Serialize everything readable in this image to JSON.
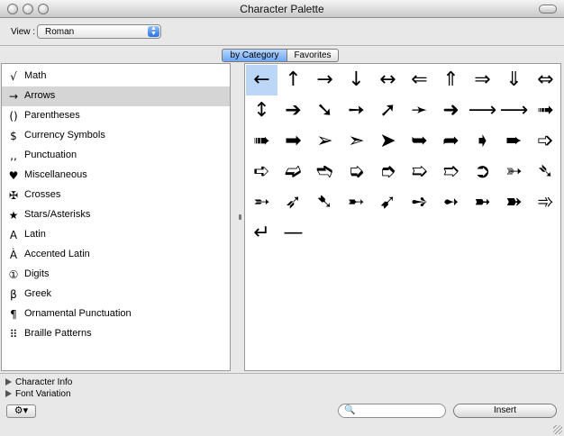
{
  "window": {
    "title": "Character Palette"
  },
  "toolbar": {
    "view_label": "View :",
    "view_value": "Roman"
  },
  "tabs": [
    {
      "label": "by Category",
      "selected": true
    },
    {
      "label": "Favorites",
      "selected": false
    }
  ],
  "categories": [
    {
      "icon": "√",
      "label": "Math"
    },
    {
      "icon": "→",
      "label": "Arrows",
      "selected": true
    },
    {
      "icon": "()",
      "label": "Parentheses"
    },
    {
      "icon": "$",
      "label": "Currency Symbols"
    },
    {
      "icon": "‚‚",
      "label": "Punctuation"
    },
    {
      "icon": "♥",
      "label": "Miscellaneous"
    },
    {
      "icon": "✠",
      "label": "Crosses"
    },
    {
      "icon": "★",
      "label": "Stars/Asterisks"
    },
    {
      "icon": "A",
      "label": "Latin"
    },
    {
      "icon": "À",
      "label": "Accented Latin"
    },
    {
      "icon": "①",
      "label": "Digits"
    },
    {
      "icon": "β",
      "label": "Greek"
    },
    {
      "icon": "¶",
      "label": "Ornamental Punctuation"
    },
    {
      "icon": "⠿",
      "label": "Braille Patterns"
    }
  ],
  "characters": [
    "←",
    "↑",
    "→",
    "↓",
    "↔",
    "⇐",
    "⇑",
    "⇒",
    "⇓",
    "⇔",
    "↕",
    "➔",
    "➘",
    "➙",
    "➚",
    "➛",
    "➜",
    "⟶",
    "⟶",
    "➟",
    "➠",
    "➡",
    "➢",
    "➣",
    "➤",
    "➥",
    "➦",
    "➧",
    "➨",
    "➩",
    "➪",
    "➫",
    "➬",
    "➭",
    "➮",
    "➯",
    "➱",
    "➲",
    "➳",
    "➴",
    "➵",
    "➶",
    "➷",
    "➸",
    "➹",
    "➺",
    "➻",
    "➼",
    "➽",
    "➾",
    "↵",
    "—"
  ],
  "selected_character_index": 0,
  "disclosures": [
    {
      "label": "Character Info"
    },
    {
      "label": "Font Variation"
    }
  ],
  "bottom": {
    "gear_glyph": "⚙▾",
    "search_glyph": "🔍",
    "search_value": "",
    "insert_label": "Insert"
  }
}
